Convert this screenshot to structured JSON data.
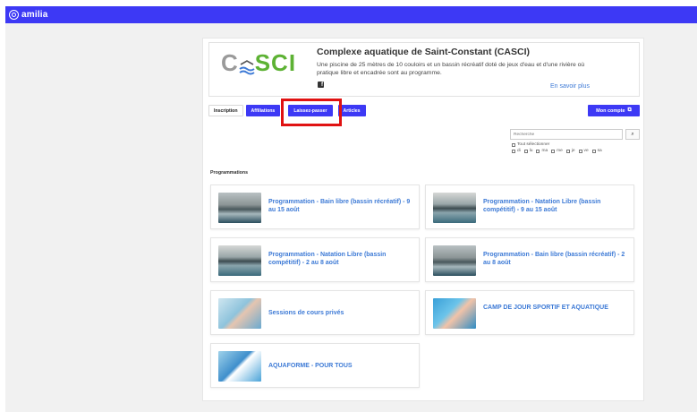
{
  "topbar": {
    "brand": "amilia",
    "color": "#3d39f5"
  },
  "organization": {
    "logo_text_c": "C",
    "logo_text_sci": "SCI",
    "title": "Complexe aquatique de Saint-Constant (CASCI)",
    "description": "Une piscine de 25 mètres de 10 couloirs et un bassin récréatif doté de jeux d'eau et d'une rivière où pratique libre et encadrée sont au programme.",
    "facebook_icon": "facebook-icon",
    "more_link": "En savoir plus"
  },
  "tabs": [
    {
      "label": "Inscription",
      "active": false
    },
    {
      "label": "Affiliations",
      "active": true
    },
    {
      "label": "Laissez-passer",
      "active": true
    },
    {
      "label": "Articles",
      "active": true
    }
  ],
  "account_button": "Mon compte",
  "filters": {
    "search_placeholder": "Recherche",
    "select_all": "Tout sélectionner",
    "days": [
      "di",
      "lu",
      "ma",
      "me",
      "je",
      "ve",
      "sa"
    ]
  },
  "section_title": "Programmations",
  "programs": [
    {
      "title": "Programmation - Bain libre (bassin récréatif) - 9 au 15 août",
      "thumb": "pool"
    },
    {
      "title": "Programmation - Natation Libre (bassin compétitif) - 9 au 15 août",
      "thumb": "pool2"
    },
    {
      "title": "Programmation - Natation Libre (bassin compétitif) - 2 au 8 août",
      "thumb": "pool2"
    },
    {
      "title": "Programmation - Bain libre (bassin récréatif) - 2 au 8 août",
      "thumb": "pool"
    },
    {
      "title": "Sessions de cours privés",
      "thumb": "swim"
    },
    {
      "title": "CAMP DE JOUR SPORTIF ET AQUATIQUE",
      "thumb": "kids"
    },
    {
      "title": "AQUAFORME - POUR TOUS",
      "thumb": "aqua"
    }
  ]
}
